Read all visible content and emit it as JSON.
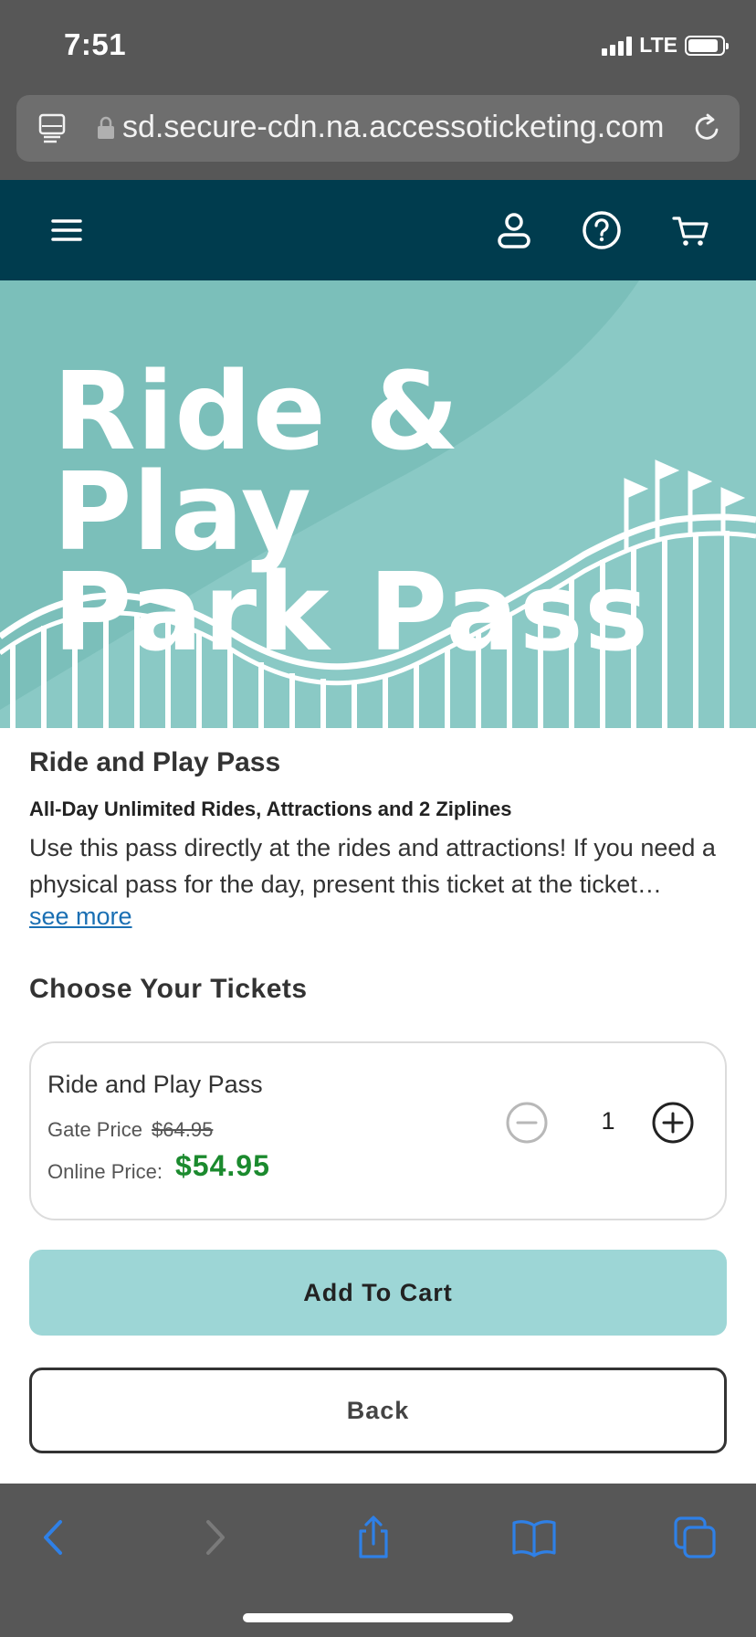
{
  "status_bar": {
    "time": "7:51",
    "network": "LTE"
  },
  "browser": {
    "url": "sd.secure-cdn.na.accessoticketing.com"
  },
  "header": {
    "icons": [
      "menu-icon",
      "user-icon",
      "help-icon",
      "cart-icon"
    ],
    "background_color": "#003c4e"
  },
  "hero": {
    "line1": "Ride & Play",
    "line2": "Park Pass",
    "background_color": "#8ac9c5"
  },
  "product": {
    "name": "Ride and Play Pass",
    "subtitle": "All-Day Unlimited Rides, Attractions and 2 Ziplines",
    "description": "Use this pass directly at the rides and attractions! If you need a physical pass for the day, present this ticket at the ticket…",
    "see_more": "see more"
  },
  "tickets": {
    "section_title": "Choose Your Tickets",
    "items": [
      {
        "name": "Ride and Play Pass",
        "gate_label": "Gate Price",
        "gate_price": "$64.95",
        "online_label": "Online Price:",
        "online_price": "$54.95",
        "quantity": "1"
      }
    ]
  },
  "actions": {
    "add_to_cart": "Add To Cart",
    "back": "Back",
    "accent_color": "#9dd6d6",
    "price_color": "#1b8a2e"
  },
  "toolbar": {
    "icons": [
      "back-arrow-icon",
      "forward-arrow-icon",
      "share-icon",
      "bookmarks-icon",
      "tabs-icon"
    ]
  }
}
